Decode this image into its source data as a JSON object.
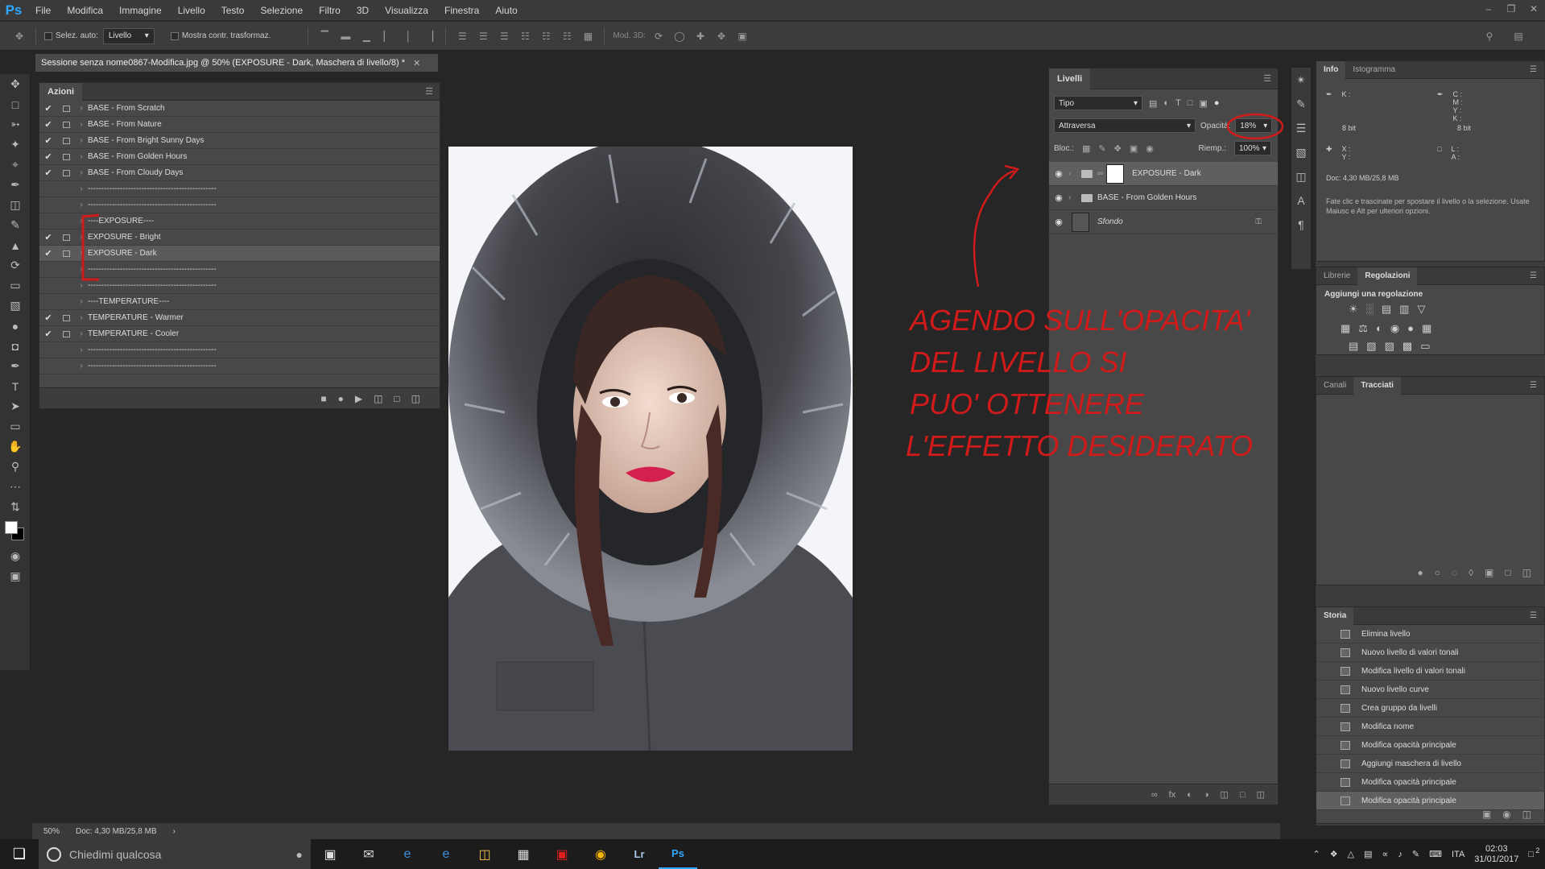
{
  "app": {
    "logo": "Ps",
    "title": "Sessione senza nome0867-Modifica.jpg @ 50% (EXPOSURE - Dark, Maschera di livello/8) *"
  },
  "menu": [
    "File",
    "Modifica",
    "Immagine",
    "Livello",
    "Testo",
    "Selezione",
    "Filtro",
    "3D",
    "Visualizza",
    "Finestra",
    "Aiuto"
  ],
  "options": {
    "auto_select_label": "Selez. auto:",
    "auto_select_value": "Livello",
    "transform_label": "Mostra contr. trasformaz.",
    "mode3d_label": "Mod. 3D:"
  },
  "actions": {
    "tab": "Azioni",
    "rows": [
      {
        "check": "✔",
        "label": "BASE - From Scratch"
      },
      {
        "check": "✔",
        "label": "BASE - From Nature"
      },
      {
        "check": "✔",
        "label": "BASE - From Bright Sunny Days"
      },
      {
        "check": "✔",
        "label": "BASE - From Golden Hours"
      },
      {
        "check": "✔",
        "label": "BASE - From Cloudy Days"
      },
      {
        "check": "",
        "label": "------------------------------------------------"
      },
      {
        "check": "",
        "label": "------------------------------------------------"
      },
      {
        "check": "",
        "label": "----EXPOSURE----"
      },
      {
        "check": "✔",
        "label": "EXPOSURE - Bright"
      },
      {
        "check": "✔",
        "label": "EXPOSURE - Dark"
      },
      {
        "check": "",
        "label": "------------------------------------------------"
      },
      {
        "check": "",
        "label": "------------------------------------------------"
      },
      {
        "check": "",
        "label": "----TEMPERATURE----"
      },
      {
        "check": "✔",
        "label": "TEMPERATURE - Warmer"
      },
      {
        "check": "✔",
        "label": "TEMPERATURE - Cooler"
      },
      {
        "check": "",
        "label": "------------------------------------------------"
      },
      {
        "check": "",
        "label": "------------------------------------------------"
      }
    ]
  },
  "layers": {
    "tab": "Livelli",
    "filter": "Tipo",
    "blend_mode": "Attraversa",
    "opacity_label": "Opacità:",
    "opacity_value": "18%",
    "lock_label": "Bloc.:",
    "fill_label": "Riemp.:",
    "fill_value": "100%",
    "rows": [
      {
        "name": "EXPOSURE - Dark"
      },
      {
        "name": "BASE - From Golden Hours"
      },
      {
        "name": "Sfondo"
      }
    ]
  },
  "info": {
    "tabs": [
      "Info",
      "Istogramma"
    ],
    "left_channels": "K :",
    "left_bits": "8 bit",
    "right_channels": "C :\nM :\nY :\nK :",
    "right_bits": "8 bit",
    "xy": "X :\nY :",
    "la": "L :\nA :",
    "doc": "Doc: 4,30 MB/25,8 MB",
    "hint": "Fate clic e trascinate per spostare il livello o la selezione. Usate Maiusc e Alt per ulteriori opzioni."
  },
  "adjustments": {
    "tabs": [
      "Librerie",
      "Regolazioni"
    ],
    "title": "Aggiungi una regolazione"
  },
  "paths": {
    "tabs": [
      "Canali",
      "Tracciati"
    ]
  },
  "history": {
    "tab": "Storia",
    "rows": [
      "Elimina livello",
      "Nuovo livello di valori tonali",
      "Modifica livello di valori tonali",
      "Nuovo livello curve",
      "Crea gruppo da livelli",
      "Modifica nome",
      "Modifica opacità principale",
      "Aggiungi maschera di livello",
      "Modifica opacità principale",
      "Modifica opacità principale"
    ]
  },
  "annotation": {
    "lines": [
      "AGENDO SULL'OPACITA'",
      "DEL LIVELLO SI",
      "PUO' OTTENERE",
      "L'EFFETTO DESIDERATO"
    ]
  },
  "status": {
    "zoom": "50%",
    "doc": "Doc: 4,30 MB/25,8 MB"
  },
  "taskbar": {
    "search_placeholder": "Chiedimi qualcosa",
    "lang": "ITA",
    "time": "02:03",
    "date": "31/01/2017",
    "notif_count": "2"
  },
  "colors": {
    "accent": "#31a8ff",
    "annotation": "#d11a1a"
  }
}
